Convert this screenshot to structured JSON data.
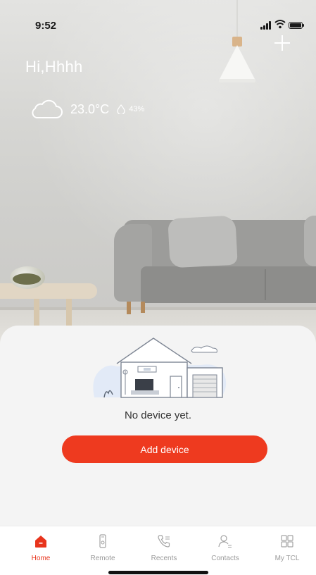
{
  "status_bar": {
    "time": "9:52"
  },
  "header": {
    "greeting": "Hi,Hhhh",
    "add_icon": "plus-icon"
  },
  "weather": {
    "icon": "cloud-icon",
    "temperature": "23.0°C",
    "humidity_icon": "droplet-icon",
    "humidity": "43%"
  },
  "empty_state": {
    "illustration": "house-illustration",
    "message": "No device yet.",
    "button_label": "Add device"
  },
  "tabs": [
    {
      "label": "Home",
      "icon": "home-icon",
      "active": true
    },
    {
      "label": "Remote",
      "icon": "remote-icon",
      "active": false
    },
    {
      "label": "Recents",
      "icon": "phone-icon",
      "active": false
    },
    {
      "label": "Contacts",
      "icon": "contacts-icon",
      "active": false
    },
    {
      "label": "My TCL",
      "icon": "grid-icon",
      "active": false
    }
  ],
  "colors": {
    "accent": "#ee3a1f",
    "tab_active": "#e8341c",
    "tab_inactive": "#9a9a9a"
  }
}
